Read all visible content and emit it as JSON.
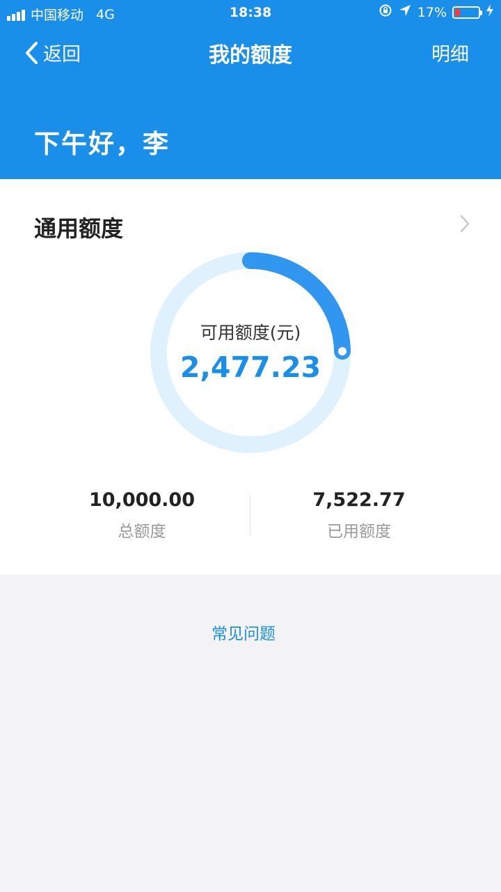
{
  "status_bar": {
    "carrier": "中国移动",
    "network": "4G",
    "time": "18:38",
    "battery": "17%",
    "battery_level": 0.17,
    "icons": [
      "signal-icon",
      "lock-rotation-icon",
      "location-icon",
      "battery-icon",
      "charging-icon"
    ]
  },
  "nav": {
    "back_label": "返回",
    "title": "我的额度",
    "detail_label": "明细"
  },
  "greeting": "下午好，李",
  "card": {
    "title": "通用额度",
    "ring_label": "可用额度(元)",
    "available": "2,477.23",
    "available_fraction": 0.2477,
    "total_value": "10,000.00",
    "total_label": "总额度",
    "used_value": "7,522.77",
    "used_label": "已用额度"
  },
  "faq_label": "常见问题",
  "colors": {
    "primary": "#1a8fea",
    "ring_track": "#dff1fd",
    "ring_progress": "#3196f0",
    "background": "#f3f3f6"
  }
}
